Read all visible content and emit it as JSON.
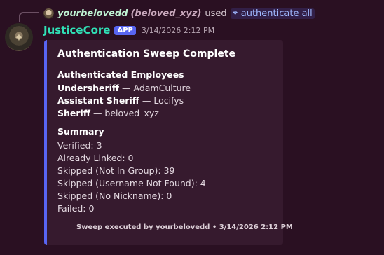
{
  "reply": {
    "user": "yourbelovedd",
    "handle": "(beloved_xyz)",
    "used_text": "used",
    "command": "authenticate all"
  },
  "message": {
    "bot_name": "JusticeCore",
    "tag": "APP",
    "timestamp": "3/14/2026 2:12 PM"
  },
  "embed": {
    "title": "Authentication Sweep Complete",
    "employees_heading": "Authenticated Employees",
    "employees": [
      {
        "role": "Undersheriff",
        "sep": " — ",
        "name": "AdamCulture"
      },
      {
        "role": "Assistant Sheriff",
        "sep": " — ",
        "name": "Locifys"
      },
      {
        "role": "Sheriff",
        "sep": " — ",
        "name": "beloved_xyz"
      }
    ],
    "summary_heading": "Summary",
    "summary_lines": [
      "Verified: 3",
      "Already Linked: 0",
      "Skipped (Not In Group): 39",
      "Skipped (Username Not Found): 4",
      "Skipped (No Nickname): 0",
      "Failed: 0"
    ],
    "footer": "Sweep executed by yourbelovedd • 3/14/2026 2:12 PM"
  },
  "icons": {
    "command": "slash-command-icon",
    "avatar": "sheriff-badge-icon"
  },
  "colors": {
    "background": "#2a1022",
    "embed_background": "#361a2e",
    "embed_accent": "#5865f2",
    "bot_name": "#30e0b6",
    "reply_user": "#bff3d3"
  }
}
